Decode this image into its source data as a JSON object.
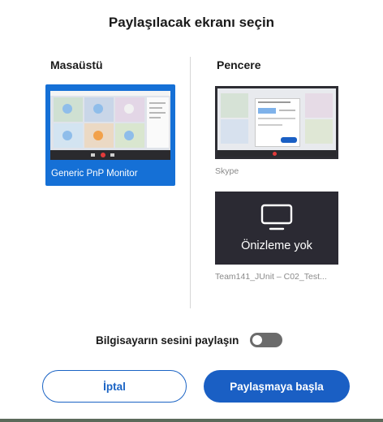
{
  "dialog": {
    "title": "Paylaşılacak ekranı seçin"
  },
  "desktop": {
    "heading": "Masaüstü",
    "tiles": [
      {
        "label": "Generic PnP Monitor",
        "selected": true
      }
    ]
  },
  "windows": {
    "heading": "Pencere",
    "tiles": [
      {
        "label": "Skype"
      },
      {
        "label": "Team141_JUnit – C02_Test...",
        "preview_text": "Önizleme yok",
        "icon": "monitor-icon"
      }
    ]
  },
  "audio": {
    "label": "Bilgisayarın sesini paylaşın",
    "enabled": false
  },
  "buttons": {
    "cancel": "İptal",
    "start": "Paylaşmaya başla"
  },
  "colors": {
    "accent": "#1a5fc4",
    "selected_tile": "#1570d6",
    "toggle_off": "#6b6b6b",
    "no_preview_bg": "#2b2a33"
  }
}
